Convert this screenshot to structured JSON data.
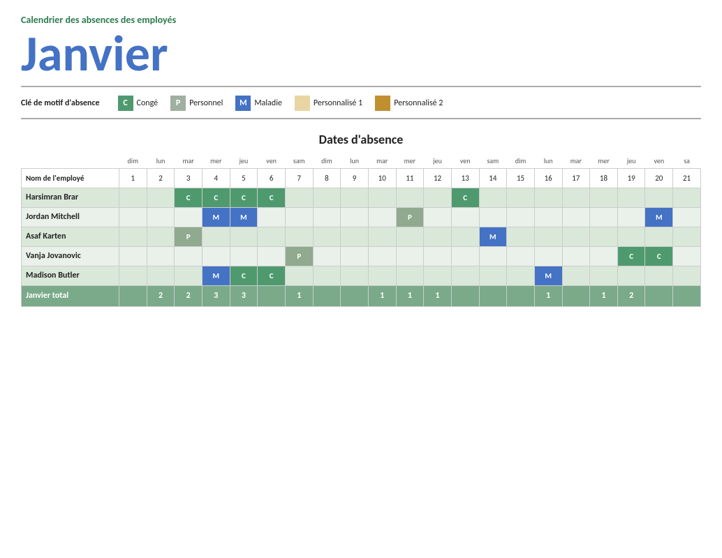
{
  "header": {
    "subtitle": "Calendrier des absences des employés",
    "title": "Janvier"
  },
  "legend": {
    "label": "Clé de motif d'absence",
    "items": [
      {
        "key": "C",
        "label": "Congé",
        "class": "conge"
      },
      {
        "key": "P",
        "label": "Personnel",
        "class": "personnel"
      },
      {
        "key": "M",
        "label": "Maladie",
        "class": "maladie"
      },
      {
        "key": "",
        "label": "Personnalisé 1",
        "class": "custom1"
      },
      {
        "key": "",
        "label": "Personnalisé 2",
        "class": "custom2"
      }
    ]
  },
  "section_title": "Dates d'absence",
  "days_of_week": [
    "dim",
    "lun",
    "mar",
    "mer",
    "jeu",
    "ven",
    "sam",
    "dim",
    "lun",
    "mar",
    "mer",
    "jeu",
    "ven",
    "sam",
    "dim",
    "lun",
    "mar",
    "mer",
    "jeu",
    "ven",
    "sa"
  ],
  "day_numbers": [
    1,
    2,
    3,
    4,
    5,
    6,
    7,
    8,
    9,
    10,
    11,
    12,
    13,
    14,
    15,
    16,
    17,
    18,
    19,
    20,
    21
  ],
  "col_header": "Nom de l'employé",
  "employees": [
    {
      "name": "Harsimran Brar",
      "absences": {
        "3": "C",
        "4": "C",
        "5": "C",
        "6": "C",
        "13": "C"
      }
    },
    {
      "name": "Jordan Mitchell",
      "absences": {
        "4": "M",
        "5": "M",
        "11": "P",
        "20": "M"
      }
    },
    {
      "name": "Asaf Karten",
      "absences": {
        "3": "P",
        "14": "M"
      }
    },
    {
      "name": "Vanja Jovanovic",
      "absences": {
        "7": "P",
        "19": "C",
        "20": "C"
      }
    },
    {
      "name": "Madison Butler",
      "absences": {
        "4": "M",
        "5": "C",
        "6": "C",
        "16": "M"
      }
    }
  ],
  "totals": {
    "label": "Janvier total",
    "values": {
      "2": "2",
      "3": "2",
      "4": "3",
      "5": "3",
      "7": "1",
      "10": "1",
      "11": "1",
      "12": "1",
      "16": "1",
      "18": "1",
      "19": "2"
    }
  }
}
